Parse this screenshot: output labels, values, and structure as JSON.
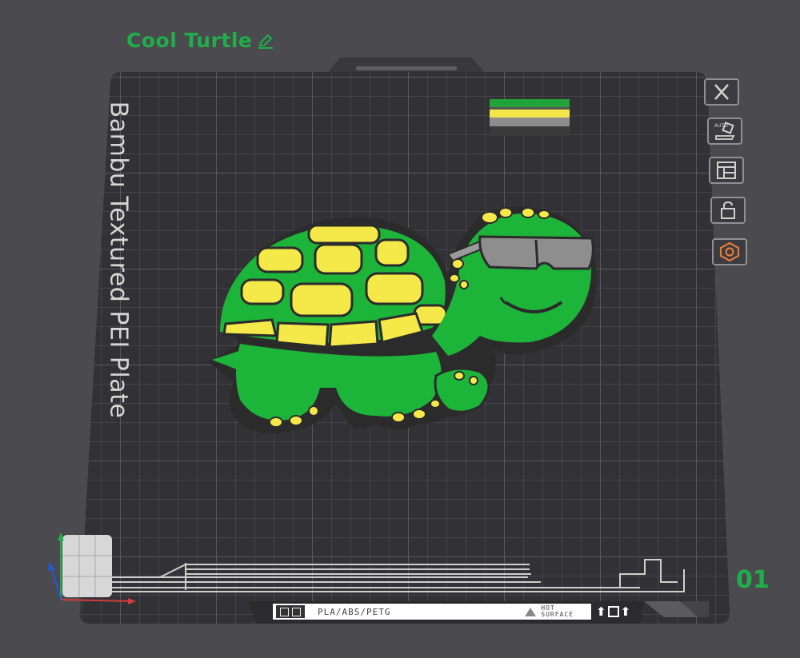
{
  "plate": {
    "name": "Cool Turtle",
    "number": "01",
    "label": "Bambu Textured PEI Plate",
    "name_color": "#1fae4a"
  },
  "toolbar": {
    "items": [
      {
        "name": "close-plate",
        "icon": "close-icon"
      },
      {
        "name": "auto-orient",
        "icon": "auto-orient-icon",
        "label": "AUTO"
      },
      {
        "name": "arrange",
        "icon": "arrange-icon"
      },
      {
        "name": "lock-plate",
        "icon": "lock-icon"
      },
      {
        "name": "plate-settings",
        "icon": "settings-nut-icon",
        "accent": "#e07b39"
      }
    ]
  },
  "bottom_bar": {
    "material": "PLA/ABS/PETG",
    "hot_line1": "HOT",
    "hot_line2": "SURFACE"
  },
  "filament_swatch": {
    "colors": [
      "#22a33a",
      "#f3e54a",
      "#8c8c8c",
      "#3a3a3a"
    ]
  },
  "model": {
    "name": "cool-turtle",
    "colors": {
      "body": "#1db43a",
      "shell_patch": "#f5e94a",
      "outline": "#2b2b2b",
      "glasses": "#8e8e8e"
    }
  }
}
